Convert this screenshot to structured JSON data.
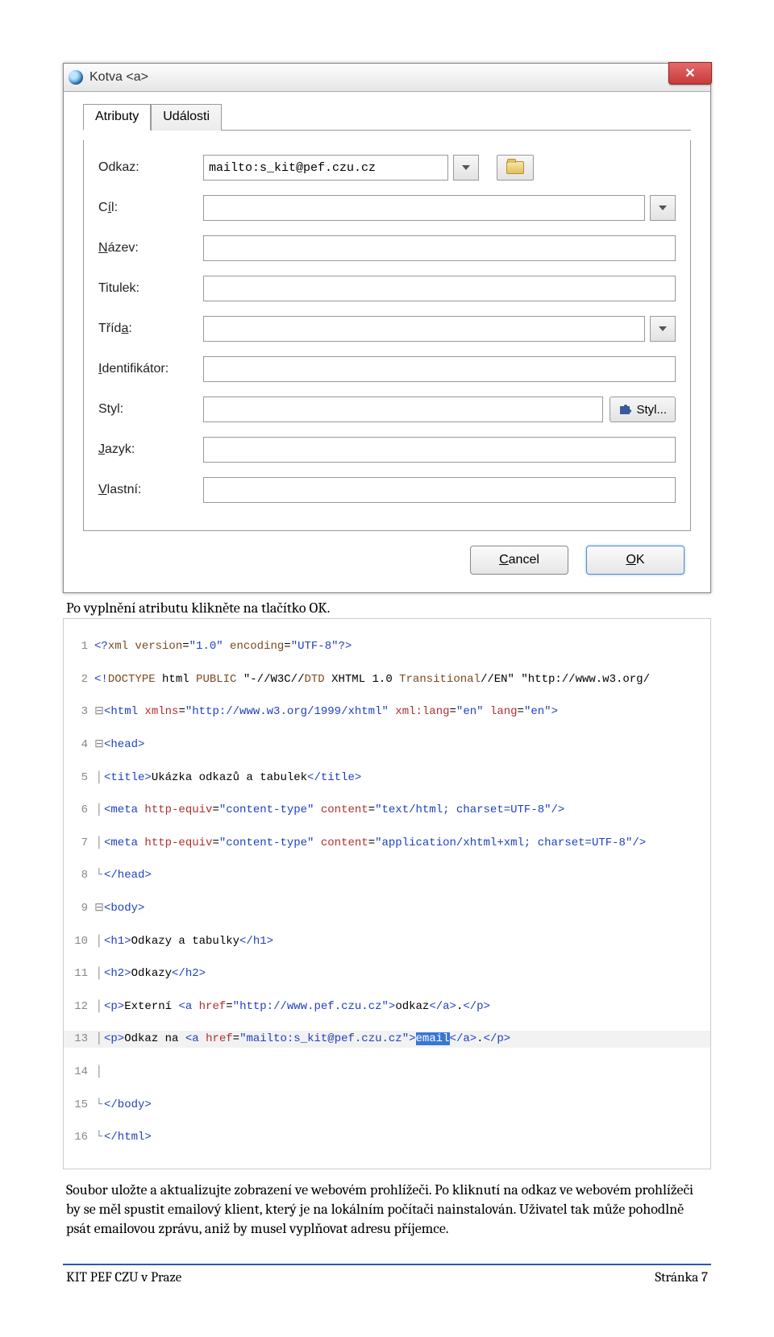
{
  "dialog": {
    "title": "Kotva <a>",
    "tabs": {
      "attrs": "Atributy",
      "events": "Události"
    },
    "fields": {
      "odkaz": {
        "label": "Odkaz:",
        "value": "mailto:s_kit@pef.czu.cz"
      },
      "cil": {
        "label_pre": "C",
        "label_u": "í",
        "label_post": "l:"
      },
      "nazev": {
        "label_u": "N",
        "label_post": "ázev:"
      },
      "titulek": {
        "label": "Titulek:"
      },
      "trida": {
        "label_pre": "Tříd",
        "label_u": "a",
        "label_post": ":"
      },
      "ident": {
        "label_u": "I",
        "label_post": "dentifikátor:"
      },
      "styl": {
        "label": "Styl:",
        "btn": "Styl..."
      },
      "jazyk": {
        "label_u": "J",
        "label_post": "azyk:"
      },
      "vlastni": {
        "label_u": "V",
        "label_post": "lastní:"
      }
    },
    "buttons": {
      "cancel_u": "C",
      "cancel_post": "ancel",
      "ok_u": "O",
      "ok_post": "K"
    }
  },
  "caption1": "Po vyplnění atributu klikněte na tlačítko OK.",
  "code": {
    "l1": {
      "a": "<?",
      "b": "xml version",
      "c": "=",
      "d": "\"1.0\"",
      "e": " encoding",
      "f": "=",
      "g": "\"UTF-8\"",
      "h": "?>"
    },
    "l2": {
      "a": "<!",
      "b": "DOCTYPE",
      "c": " html ",
      "d": "PUBLIC",
      "e": " \"-//W3C//",
      "f": "DTD",
      "g": " XHTML 1.0 ",
      "h": "Transitional",
      "i": "//EN\" \"http://www.w3.org/"
    },
    "l3": {
      "a": "<html ",
      "b": "xmlns",
      "c": "=",
      "d": "\"http://www.w3.org/1999/xhtml\"",
      "e": " xml:lang",
      "f": "=",
      "g": "\"en\"",
      "h": " lang",
      "i": "=",
      "j": "\"en\"",
      "k": ">"
    },
    "l4": "<head>",
    "l5": {
      "a": "<title>",
      "b": "Ukázka odkazů a tabulek",
      "c": "</title>"
    },
    "l6": {
      "a": "<meta ",
      "b": "http-equiv",
      "c": "=",
      "d": "\"content-type\"",
      "e": " content",
      "f": "=",
      "g": "\"text/html; charset=UTF-8\"",
      "h": "/>"
    },
    "l7": {
      "a": "<meta ",
      "b": "http-equiv",
      "c": "=",
      "d": "\"content-type\"",
      "e": " content",
      "f": "=",
      "g": "\"application/xhtml+xml; charset=UTF-8\"",
      "h": "/>"
    },
    "l8": "</head>",
    "l9": "<body>",
    "l10": {
      "a": "<h1>",
      "b": "Odkazy a tabulky",
      "c": "</h1>"
    },
    "l11": {
      "a": "<h2>",
      "b": "Odkazy",
      "c": "</h2>"
    },
    "l12": {
      "a": "<p>",
      "b": "Externí ",
      "c": "<a ",
      "d": "href",
      "e": "=",
      "f": "\"http://www.pef.czu.cz\"",
      "g": ">",
      "h": "odkaz",
      "i": "</a>",
      "j": ".",
      "k": "</p>"
    },
    "l13": {
      "a": "<p>",
      "b": "Odkaz na ",
      "c": "<a ",
      "d": "href",
      "e": "=",
      "f": "\"mailto:s_kit@pef.czu.cz\"",
      "g": ">",
      "h": "email",
      "i": "</a>",
      "j": ".",
      "k": "</p>"
    },
    "l15": "</body>",
    "l16": "</html>"
  },
  "para2": "Soubor uložte a aktualizujte zobrazení ve webovém prohlížeči. Po kliknutí na odkaz ve webovém prohlížeči by se měl spustit emailový klient, který je na lokálním počítači nainstalován. Uživatel tak může pohodlně psát emailovou zprávu,  aniž by musel vyplňovat adresu příjemce.",
  "footer": {
    "left": "KIT PEF CZU v Praze",
    "right": "Stránka 7"
  }
}
